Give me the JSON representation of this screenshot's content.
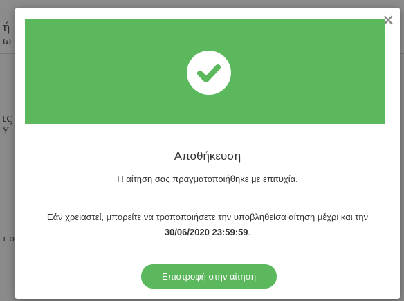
{
  "background": {
    "fragments": [
      "ή",
      "ω",
      "ις",
      "Υ",
      "ι ο"
    ]
  },
  "modal": {
    "close_glyph": "×",
    "title": "Αποθήκευση",
    "subtitle": "Η αίτηση σας πραγματοποιήθηκε με επιτυχία.",
    "info_text": "Εάν χρειαστεί, μπορείτε να τροποποιήσετε την υποβληθείσα αίτηση μέχρι και την",
    "deadline": "30/06/2020 23:59:59",
    "deadline_suffix": ".",
    "return_button": "Επιστροφή στην αίτηση",
    "icon": "check-circle-icon",
    "accent_color": "#5cb85c"
  }
}
